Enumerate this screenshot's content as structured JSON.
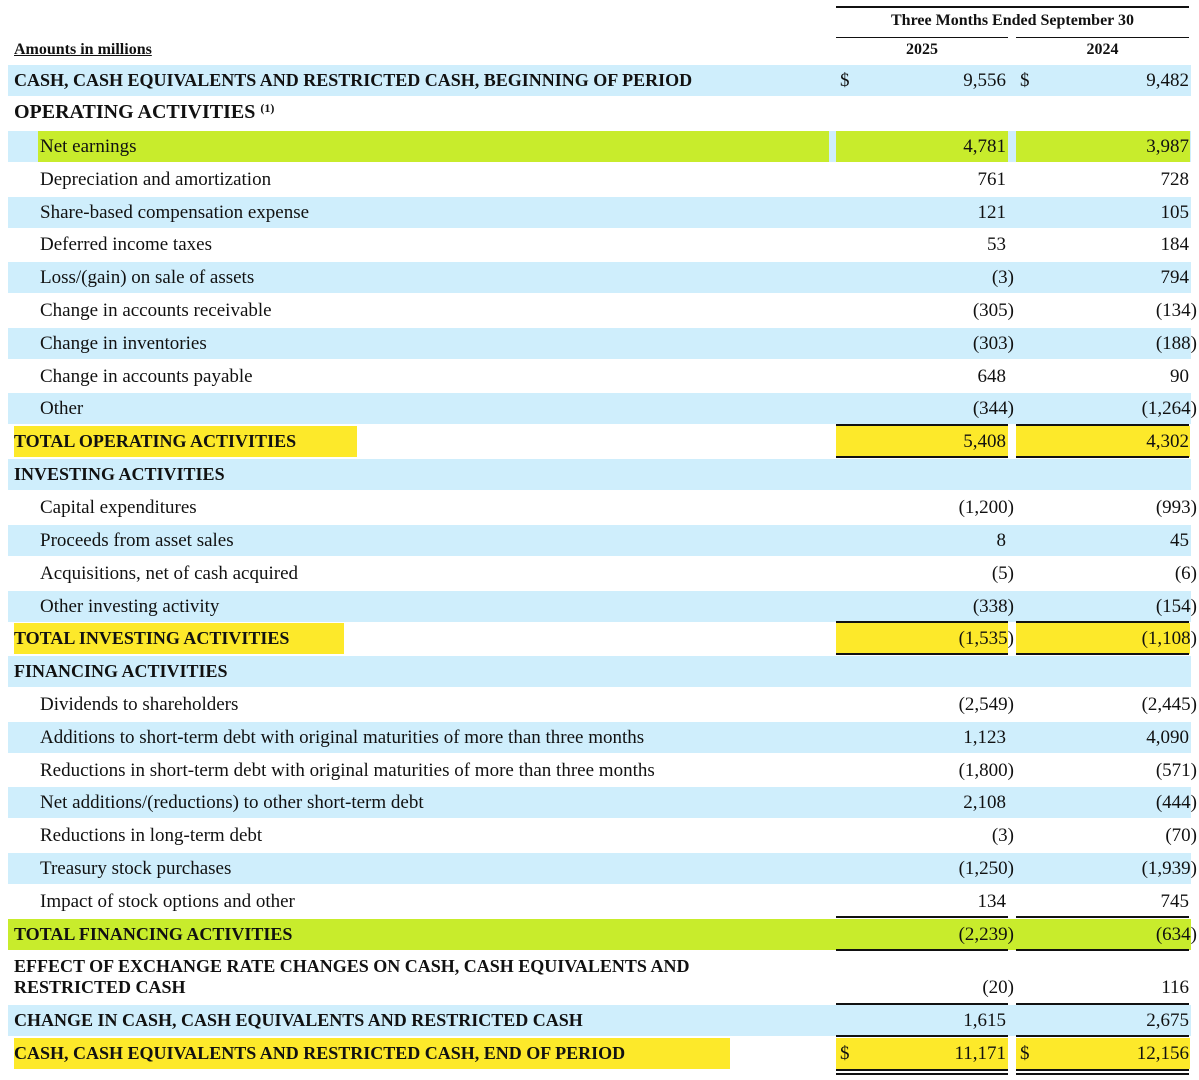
{
  "header": {
    "period": "Three Months Ended September 30",
    "year1": "2025",
    "year2": "2024",
    "amounts": "Amounts in millions"
  },
  "rows": {
    "begin": {
      "label": "CASH, CASH EQUIVALENTS AND RESTRICTED CASH, BEGINNING OF PERIOD",
      "cur": "$",
      "v1": "9,556",
      "v2": "9,482"
    },
    "op_head": {
      "label": "OPERATING ACTIVITIES",
      "sup": "(1)"
    },
    "net_earnings": {
      "label": "Net earnings",
      "v1": "4,781",
      "v2": "3,987"
    },
    "dep": {
      "label": "Depreciation and amortization",
      "v1": "761",
      "v2": "728"
    },
    "sbc": {
      "label": "Share-based compensation expense",
      "v1": "121",
      "v2": "105"
    },
    "dit": {
      "label": "Deferred income taxes",
      "v1": "53",
      "v2": "184"
    },
    "loss": {
      "label": "Loss/(gain) on sale of assets",
      "v1": "(3)",
      "v2": "794"
    },
    "ar": {
      "label": "Change in accounts receivable",
      "v1": "(305)",
      "v2": "(134)"
    },
    "inv": {
      "label": "Change in inventories",
      "v1": "(303)",
      "v2": "(188)"
    },
    "ap": {
      "label": "Change in accounts payable",
      "v1": "648",
      "v2": "90"
    },
    "other": {
      "label": "Other",
      "v1": "(344)",
      "v2": "(1,264)"
    },
    "total_op": {
      "label": "TOTAL OPERATING ACTIVITIES",
      "v1": "5,408",
      "v2": "4,302"
    },
    "inv_head": {
      "label": "INVESTING ACTIVITIES"
    },
    "capex": {
      "label": "Capital expenditures",
      "v1": "(1,200)",
      "v2": "(993)"
    },
    "proceeds": {
      "label": "Proceeds from asset sales",
      "v1": "8",
      "v2": "45"
    },
    "acq": {
      "label": "Acquisitions, net of cash acquired",
      "v1": "(5)",
      "v2": "(6)"
    },
    "oth_inv": {
      "label": "Other investing activity",
      "v1": "(338)",
      "v2": "(154)"
    },
    "total_inv": {
      "label": "TOTAL INVESTING ACTIVITIES",
      "v1": "(1,535)",
      "v2": "(1,108)"
    },
    "fin_head": {
      "label": "FINANCING ACTIVITIES"
    },
    "div": {
      "label": "Dividends to shareholders",
      "v1": "(2,549)",
      "v2": "(2,445)"
    },
    "add_st": {
      "label": "Additions to short-term debt with original maturities of more than three months",
      "v1": "1,123",
      "v2": "4,090"
    },
    "red_st": {
      "label": "Reductions in short-term debt with original maturities of more than three months",
      "v1": "(1,800)",
      "v2": "(571)"
    },
    "net_st": {
      "label": "Net additions/(reductions) to other short-term debt",
      "v1": "2,108",
      "v2": "(444)"
    },
    "red_lt": {
      "label": "Reductions in long-term debt",
      "v1": "(3)",
      "v2": "(70)"
    },
    "treasury": {
      "label": "Treasury stock purchases",
      "v1": "(1,250)",
      "v2": "(1,939)"
    },
    "stock_opt": {
      "label": "Impact of stock options and other",
      "v1": "134",
      "v2": "745"
    },
    "total_fin": {
      "label": "TOTAL FINANCING ACTIVITIES",
      "v1": "(2,239)",
      "v2": "(634)"
    },
    "fx": {
      "label1": "EFFECT OF EXCHANGE RATE CHANGES ON CASH, CASH EQUIVALENTS AND",
      "label2": "RESTRICTED CASH",
      "v1": "(20)",
      "v2": "116"
    },
    "change": {
      "label": "CHANGE IN CASH, CASH EQUIVALENTS AND RESTRICTED CASH",
      "v1": "1,615",
      "v2": "2,675"
    },
    "end": {
      "label": "CASH, CASH EQUIVALENTS AND RESTRICTED CASH, END OF PERIOD",
      "cur": "$",
      "v1": "11,171",
      "v2": "12,156"
    }
  },
  "colors": {
    "row_blue": "#cfeefc",
    "highlight_lime": "#c8ec2c",
    "highlight_yellow": "#fde92a"
  }
}
